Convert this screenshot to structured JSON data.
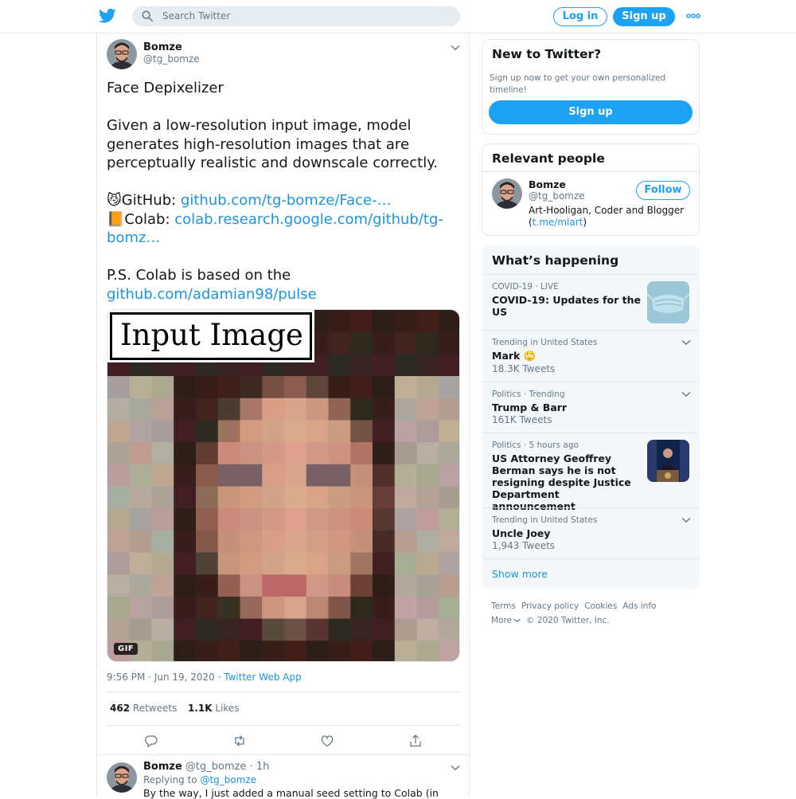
{
  "topbar": {
    "search_placeholder": "Search Twitter",
    "login_label": "Log in",
    "signup_label": "Sign up"
  },
  "tweet": {
    "author_name": "Bomze",
    "author_handle": "@tg_bomze",
    "title": "Face Depixelizer",
    "body": "Given a low-resolution input image, model generates high-resolution images that are perceptually realistic and downscale correctly.",
    "github_prefix": "😼GitHub: ",
    "github_link": "github.com/tg-bomze/Face-…",
    "colab_prefix": "📙Colab: ",
    "colab_link": "colab.research.google.com/github/tg-bomz…",
    "ps_text": "P.S. Colab is based on the",
    "ps_link": "github.com/adamian98/pulse",
    "media_label": "Input Image",
    "gif_badge": "GIF",
    "time": "9:56 PM · Jun 19, 2020 · ",
    "source": "Twitter Web App",
    "retweets_count": "462",
    "retweets_label": "Retweets",
    "likes_count": "1.1K",
    "likes_label": "Likes"
  },
  "reply": {
    "author_name": "Bomze",
    "author_meta": "@tg_bomze · 1h",
    "replying_prefix": "Replying to ",
    "replying_handle": "@tg_bomze",
    "text": "By the way, I just added a manual seed setting to Colab (in"
  },
  "sidebar": {
    "new": {
      "title": "New to Twitter?",
      "subtitle": "Sign up now to get your own personalized timeline!",
      "button": "Sign up"
    },
    "relevant": {
      "title": "Relevant people",
      "name": "Bomze",
      "handle": "@tg_bomze",
      "follow": "Follow",
      "bio_prefix": "Art-Hooligan, Coder and Blogger (",
      "bio_link": "t.me/mlart",
      "bio_suffix": ")"
    },
    "trends": {
      "title": "What’s happening",
      "items": [
        {
          "context": "COVID-19 · LIVE",
          "title": "COVID-19: Updates for the US",
          "count": ""
        },
        {
          "context": "Trending in United States",
          "title": "Mark 🙄",
          "count": "18.3K Tweets"
        },
        {
          "context": "Politics · Trending",
          "title": "Trump & Barr",
          "count": "161K Tweets"
        },
        {
          "context": "Politics · 5 hours ago",
          "title": "US Attorney Geoffrey Berman says he is not resigning despite Justice Department announcement",
          "count": ""
        },
        {
          "context": "Trending in United States",
          "title": "Uncle Joey",
          "count": "1,943 Tweets"
        }
      ],
      "show_more": "Show more"
    },
    "footer": {
      "terms": "Terms",
      "privacy": "Privacy policy",
      "cookies": "Cookies",
      "ads": "Ads info",
      "more": "More",
      "copyright": "© 2020 Twitter, Inc."
    }
  },
  "colors": {
    "accent": "#1da1f2",
    "link": "#1b95e0",
    "muted": "#657786",
    "border": "#e1e8ed"
  }
}
